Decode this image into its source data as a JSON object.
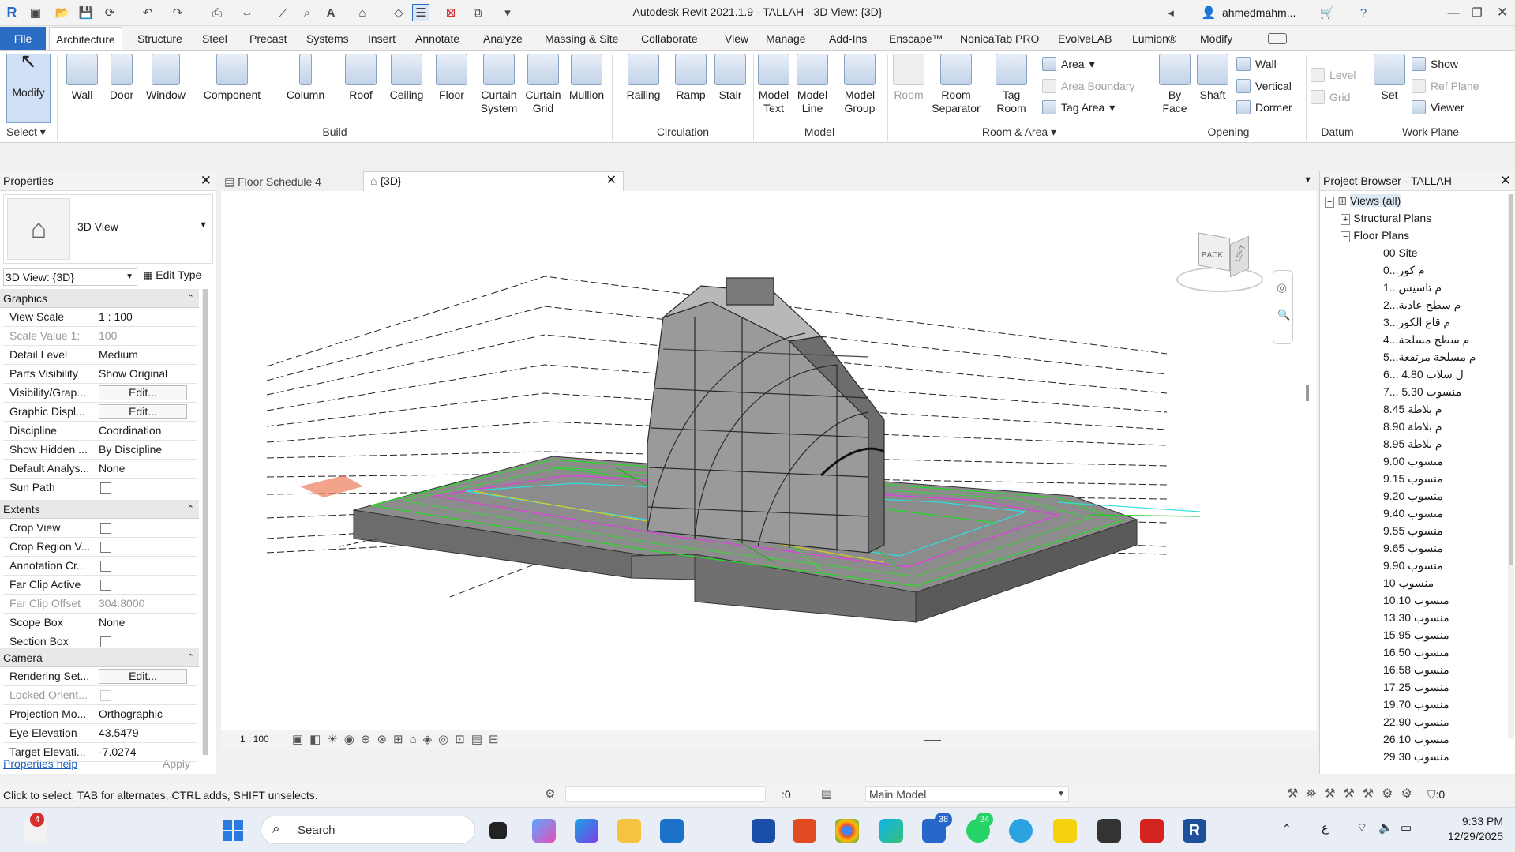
{
  "app": {
    "title": "Autodesk Revit 2021.1.9 - TALLAH - 3D View: {3D}",
    "user": "ahmedmahm..."
  },
  "tabs": [
    "File",
    "Architecture",
    "Structure",
    "Steel",
    "Precast",
    "Systems",
    "Insert",
    "Annotate",
    "Analyze",
    "Massing & Site",
    "Collaborate",
    "View",
    "Manage",
    "Add-Ins",
    "Enscape™",
    "NonicaTab PRO",
    "EvolveLAB",
    "Lumion®",
    "Modify"
  ],
  "ribbon": {
    "modify": "Modify",
    "select": "Select",
    "build": [
      "Wall",
      "Door",
      "Window",
      "Component",
      "Column",
      "Roof",
      "Ceiling",
      "Floor",
      "Curtain System",
      "Curtain Grid",
      "Mullion"
    ],
    "build_label": "Build",
    "circulation": [
      "Railing",
      "Ramp",
      "Stair"
    ],
    "circulation_label": "Circulation",
    "model": [
      "Model Text",
      "Model Line",
      "Model Group"
    ],
    "model_label": "Model",
    "room": [
      "Room",
      "Room Separator",
      "Tag Room"
    ],
    "room_small": [
      "Area",
      "Area Boundary",
      "Tag Area"
    ],
    "room_label": "Room & Area",
    "opening": [
      "By Face",
      "Shaft"
    ],
    "opening_small": [
      "Wall",
      "Vertical",
      "Dormer"
    ],
    "opening_label": "Opening",
    "datum": [
      "Level",
      "Grid"
    ],
    "datum_label": "Datum",
    "workplane": [
      "Set"
    ],
    "workplane_small": [
      "Show",
      "Ref Plane",
      "Viewer"
    ],
    "workplane_label": "Work Plane"
  },
  "properties": {
    "title": "Properties",
    "type": "3D View",
    "selector": "3D View: {3D}",
    "edit_type": "Edit Type",
    "sections": {
      "graphics": "Graphics",
      "extents": "Extents",
      "camera": "Camera"
    },
    "graphics": [
      [
        "View Scale",
        "1 : 100"
      ],
      [
        "Scale Value    1:",
        "100"
      ],
      [
        "Detail Level",
        "Medium"
      ],
      [
        "Parts Visibility",
        "Show Original"
      ],
      [
        "Visibility/Grap...",
        "Edit..."
      ],
      [
        "Graphic Displ...",
        "Edit..."
      ],
      [
        "Discipline",
        "Coordination"
      ],
      [
        "Show Hidden ...",
        "By Discipline"
      ],
      [
        "Default Analys...",
        "None"
      ],
      [
        "Sun Path",
        ""
      ]
    ],
    "extents": [
      [
        "Crop View",
        ""
      ],
      [
        "Crop Region V...",
        ""
      ],
      [
        "Annotation Cr...",
        ""
      ],
      [
        "Far Clip Active",
        ""
      ],
      [
        "Far Clip Offset",
        "304.8000"
      ],
      [
        "Scope Box",
        "None"
      ],
      [
        "Section Box",
        ""
      ]
    ],
    "camera": [
      [
        "Rendering Set...",
        "Edit..."
      ],
      [
        "Locked Orient...",
        ""
      ],
      [
        "Projection Mo...",
        "Orthographic"
      ],
      [
        "Eye Elevation",
        "43.5479"
      ],
      [
        "Target Elevati...",
        "-7.0274"
      ]
    ],
    "help": "Properties help",
    "apply": "Apply"
  },
  "view_tabs": [
    "Floor Schedule 4",
    "{3D}"
  ],
  "viewcube": {
    "back": "BACK",
    "left": "LEFT"
  },
  "view_scale": "1 : 100",
  "browser": {
    "title": "Project Browser - TALLAH",
    "root": "Views (all)",
    "structural": "Structural Plans",
    "floor": "Floor Plans",
    "items": [
      "00 Site",
      "م كور...0",
      "م تاسيس...1",
      "م سطح عادية...2",
      "م قاع الكور...3",
      "م سطح مسلحة...4",
      "م مسلحة مرتفعة...5",
      "ل سلاب 4.80 ...6",
      "منسوب 5.30 ...7",
      "م بلاطة 8.45",
      "م بلاطة 8.90",
      "م بلاطة 8.95",
      "منسوب 9.00",
      "منسوب 9.15",
      "منسوب 9.20",
      "منسوب 9.40",
      "منسوب 9.55",
      "منسوب 9.65",
      "منسوب 9.90",
      "منسوب 10",
      "منسوب 10.10",
      "منسوب 13.30",
      "منسوب 15.95",
      "منسوب 16.50",
      "منسوب 16.58",
      "منسوب 17.25",
      "منسوب 19.70",
      "منسوب 22.90",
      "منسوب 26.10",
      "منسوب 29.30"
    ]
  },
  "status": {
    "hint": "Click to select, TAB for alternates, CTRL adds, SHIFT unselects.",
    "zero": ":0",
    "model": "Main Model",
    "filter": ":0"
  },
  "taskbar": {
    "search": "Search",
    "time": "9:33 PM",
    "date": "12/29/2025",
    "badge1": "4",
    "badge2": "38",
    "badge3": "24",
    "lang": "ع"
  }
}
